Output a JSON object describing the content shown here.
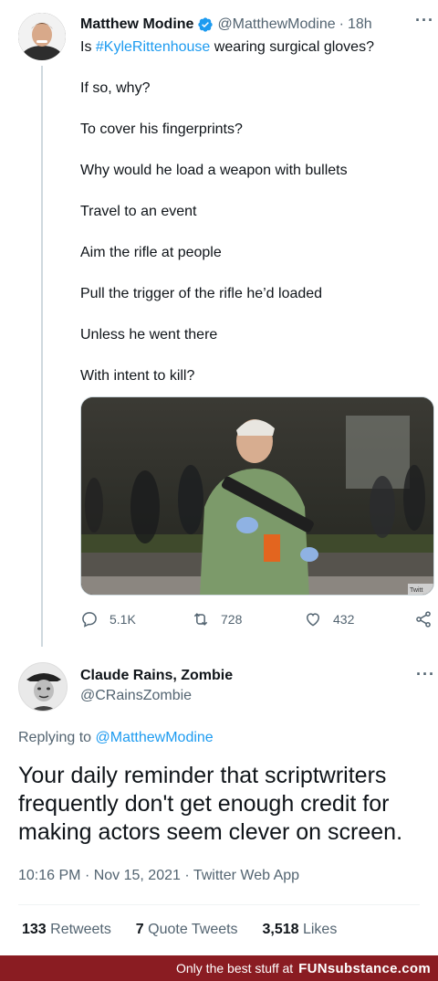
{
  "tweet": {
    "author_name": "Matthew Modine",
    "author_handle": "@MatthewModine",
    "separator": "·",
    "time_ago": "18h",
    "text_prefix": "Is ",
    "hashtag": "#KyleRittenhouse",
    "text_suffix": " wearing surgical gloves?",
    "lines": [
      "If so, why?",
      "To cover his fingerprints?",
      "Why would he load a weapon with bullets",
      "Travel to an event",
      "Aim the rifle at people",
      "Pull the trigger of the rifle he’d loaded",
      "Unless he went there",
      "With intent to kill?"
    ],
    "media_watermark": "Twitt",
    "actions": {
      "replies": "5.1K",
      "retweets": "728",
      "likes": "432"
    }
  },
  "reply": {
    "author_name": "Claude Rains, Zombie",
    "author_handle": "@CRainsZombie",
    "replying_prefix": "Replying to",
    "replying_to": "@MatthewModine",
    "text": "Your daily reminder that scriptwriters frequently don't get enough credit for making actors seem clever on screen.",
    "time": "10:16 PM",
    "date": "Nov 15, 2021",
    "source": "Twitter Web App",
    "dot": "·",
    "stats": {
      "retweets_count": "133",
      "retweets_label": "Retweets",
      "quotes_count": "7",
      "quotes_label": "Quote Tweets",
      "likes_count": "3,518",
      "likes_label": "Likes"
    }
  },
  "footer": {
    "tagline": "Only the best stuff at",
    "brand": "FUNsubstance.com"
  },
  "colors": {
    "link": "#1d9bf0",
    "secondary_text": "#536471",
    "footer_bg": "#8a1c22"
  }
}
